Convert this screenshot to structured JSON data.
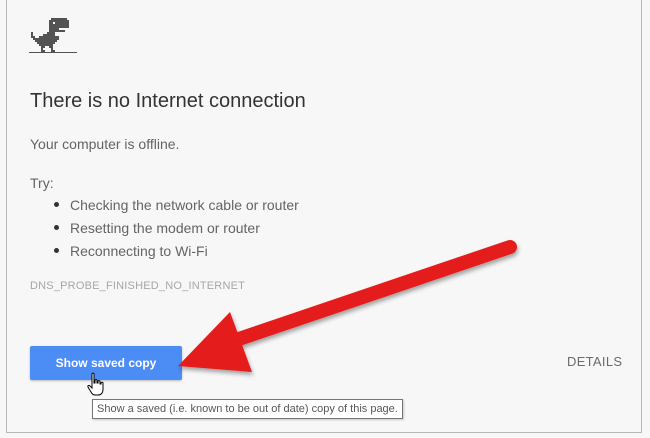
{
  "error_page": {
    "title": "There is no Internet connection",
    "subtitle": "Your computer is offline.",
    "try_label": "Try:",
    "suggestions": [
      "Checking the network cable or router",
      "Resetting the modem or router",
      "Reconnecting to Wi-Fi"
    ],
    "error_code": "DNS_PROBE_FINISHED_NO_INTERNET"
  },
  "buttons": {
    "show_saved_copy": "Show saved copy",
    "details": "DETAILS"
  },
  "tooltip": {
    "text": "Show a saved (i.e. known to be out of date) copy of this page."
  },
  "icons": {
    "dino": "dino-icon",
    "cursor": "hand-pointer-icon",
    "annotation": "red-arrow"
  },
  "colors": {
    "primary_button": "#4c8cf5",
    "annotation_arrow": "#e41b1b",
    "background": "#f7f7f7"
  }
}
